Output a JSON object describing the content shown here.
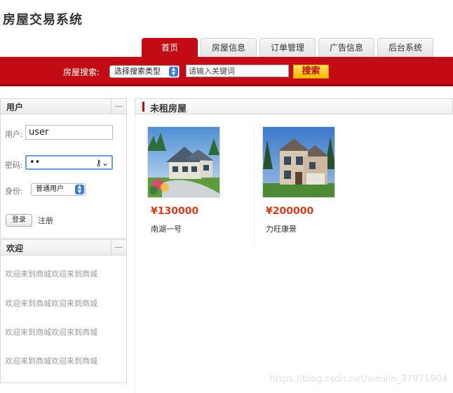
{
  "app": {
    "title": "房屋交易系统"
  },
  "tabs": [
    {
      "label": "首页",
      "active": true
    },
    {
      "label": "房屋信息",
      "active": false
    },
    {
      "label": "订单管理",
      "active": false
    },
    {
      "label": "广告信息",
      "active": false
    },
    {
      "label": "后台系统",
      "active": false
    }
  ],
  "search": {
    "label": "房屋搜索:",
    "type_selected": "选择搜索类型",
    "placeholder": "请输入关键词",
    "button": "搜索"
  },
  "user_panel": {
    "title": "用户",
    "collapse": "—",
    "username_label": "用户:",
    "username_value": "user",
    "password_label": "密码:",
    "password_value": "••",
    "role_label": "身份:",
    "role_selected": "普通用户",
    "login_button": "登录",
    "register_link": "注册"
  },
  "welcome_panel": {
    "title": "欢迎",
    "collapse": "—",
    "lines": [
      "欢迎来到商城欢迎来到商城",
      "欢迎来到商城欢迎来到商城",
      "欢迎来到商城欢迎来到商城",
      "欢迎来到商城欢迎来到商城"
    ]
  },
  "listing": {
    "title": "未租房屋",
    "houses": [
      {
        "price": "¥130000",
        "name": "南湖一号"
      },
      {
        "price": "¥200000",
        "name": "力旺康景"
      }
    ]
  },
  "watermark": "https://blog.csdn.net/weixin_37971904",
  "colors": {
    "brand_red": "#c20b14",
    "price_red": "#d93a1a",
    "search_button": "#f5b800"
  }
}
